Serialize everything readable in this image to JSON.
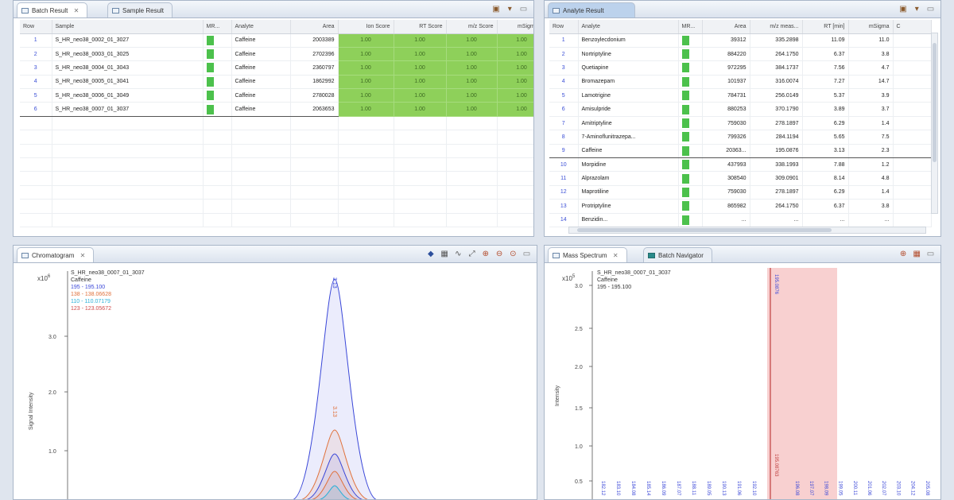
{
  "top_left": {
    "tabs": [
      {
        "label": "Batch Result"
      },
      {
        "label": "Sample Result"
      }
    ],
    "columns": [
      "Row",
      "Sample",
      "MR...",
      "Analyte",
      "Area",
      "Ion Score",
      "RT Score",
      "m/z Score",
      "mSigma..."
    ],
    "rows": [
      {
        "row": "1",
        "sample": "S_HR_neo38_0002_01_3027",
        "analyte": "Caffeine",
        "area": "2003389",
        "ion": "1.00",
        "rt": "1.00",
        "mz": "1.00",
        "msigma": "1.00"
      },
      {
        "row": "2",
        "sample": "S_HR_neo38_0003_01_3025",
        "analyte": "Caffeine",
        "area": "2702396",
        "ion": "1.00",
        "rt": "1.00",
        "mz": "1.00",
        "msigma": "1.00"
      },
      {
        "row": "3",
        "sample": "S_HR_neo38_0004_01_3043",
        "analyte": "Caffeine",
        "area": "2360797",
        "ion": "1.00",
        "rt": "1.00",
        "mz": "1.00",
        "msigma": "1.00"
      },
      {
        "row": "4",
        "sample": "S_HR_neo38_0005_01_3041",
        "analyte": "Caffeine",
        "area": "1862992",
        "ion": "1.00",
        "rt": "1.00",
        "mz": "1.00",
        "msigma": "1.00"
      },
      {
        "row": "5",
        "sample": "S_HR_neo38_0006_01_3049",
        "analyte": "Caffeine",
        "area": "2780028",
        "ion": "1.00",
        "rt": "1.00",
        "mz": "1.00",
        "msigma": "1.00"
      },
      {
        "row": "6",
        "sample": "S_HR_neo38_0007_01_3037",
        "analyte": "Caffeine",
        "area": "2063653",
        "ion": "1.00",
        "rt": "1.00",
        "mz": "1.00",
        "msigma": "1.00"
      }
    ]
  },
  "top_right": {
    "tabs": [
      {
        "label": "Analyte Result"
      }
    ],
    "columns": [
      "Row",
      "Analyte",
      "MR...",
      "Area",
      "m/z meas...",
      "RT [min]",
      "mSigma",
      "C"
    ],
    "rows": [
      {
        "row": "1",
        "analyte": "Benzoylecdonium",
        "area": "39312",
        "mz": "335.2898",
        "rt": "11.09",
        "msigma": "11.0"
      },
      {
        "row": "2",
        "analyte": "Nortriptyline",
        "area": "884220",
        "mz": "264.1750",
        "rt": "6.37",
        "msigma": "3.8"
      },
      {
        "row": "3",
        "analyte": "Quetiapine",
        "area": "972295",
        "mz": "384.1737",
        "rt": "7.56",
        "msigma": "4.7"
      },
      {
        "row": "4",
        "analyte": "Bromazepam",
        "area": "101937",
        "mz": "316.0074",
        "rt": "7.27",
        "msigma": "14.7"
      },
      {
        "row": "5",
        "analyte": "Lamotrigine",
        "area": "784731",
        "mz": "256.0149",
        "rt": "5.37",
        "msigma": "3.9"
      },
      {
        "row": "6",
        "analyte": "Amisulpride",
        "area": "880253",
        "mz": "370.1790",
        "rt": "3.89",
        "msigma": "3.7"
      },
      {
        "row": "7",
        "analyte": "Amitriptyline",
        "area": "759030",
        "mz": "278.1897",
        "rt": "6.29",
        "msigma": "1.4"
      },
      {
        "row": "8",
        "analyte": "7-Aminoflunitrazepa...",
        "area": "799326",
        "mz": "284.1194",
        "rt": "5.65",
        "msigma": "7.5"
      },
      {
        "row": "9",
        "analyte": "Caffeine",
        "area": "20363...",
        "mz": "195.0876",
        "rt": "3.13",
        "msigma": "2.3"
      },
      {
        "row": "10",
        "analyte": "Morpidine",
        "area": "437993",
        "mz": "338.1993",
        "rt": "7.88",
        "msigma": "1.2"
      },
      {
        "row": "11",
        "analyte": "Alprazolam",
        "area": "308540",
        "mz": "309.0901",
        "rt": "8.14",
        "msigma": "4.8"
      },
      {
        "row": "12",
        "analyte": "Maprotiline",
        "area": "759030",
        "mz": "278.1897",
        "rt": "6.29",
        "msigma": "1.4"
      },
      {
        "row": "13",
        "analyte": "Protriptyline",
        "area": "865982",
        "mz": "264.1750",
        "rt": "6.37",
        "msigma": "3.8"
      },
      {
        "row": "14",
        "analyte": "Benzidin...",
        "area": "...",
        "mz": "...",
        "rt": "...",
        "msigma": "..."
      }
    ]
  },
  "bottom_left": {
    "tabs": [
      {
        "label": "Chromatogram"
      }
    ],
    "y_axis_label": "Signal Intensity",
    "y_exponent": "x10",
    "y_exponent_power": "6",
    "y_ticks": [
      "3.0",
      "2.0",
      "1.0"
    ],
    "legend": [
      {
        "text": "S_HR_neo38_0007_01_3037",
        "color": "#333333"
      },
      {
        "text": "Caffeine",
        "color": "#333333"
      },
      {
        "text": "195 - 195.100",
        "color": "#3a47d8"
      },
      {
        "text": "138 - 138.06628",
        "color": "#e0703a"
      },
      {
        "text": "110 - 110.07179",
        "color": "#2ab0d8"
      },
      {
        "text": "123 - 123.05672",
        "color": "#d04a4a"
      }
    ],
    "peak_label_top": "3.13",
    "peak_label_mid": "3.13",
    "colors": {
      "blue": "#3a47d8",
      "orange": "#e0703a",
      "cyan": "#2ab0d8"
    }
  },
  "bottom_right": {
    "tabs": [
      {
        "label": "Mass Spectrum"
      },
      {
        "label": "Batch Navigator"
      }
    ],
    "y_axis_label": "Intensity",
    "y_exponent": "x10",
    "y_exponent_power": "5",
    "y_ticks": [
      "3.0",
      "2.5",
      "2.0",
      "1.5",
      "1.0",
      "0.5"
    ],
    "legend": [
      {
        "text": "S_HR_neo38_0007_01_3037"
      },
      {
        "text": "Caffeine"
      },
      {
        "text": "195 - 195.100"
      }
    ],
    "highlight_label": "195.0876",
    "peak_label": "195.08763",
    "peak_labels_left": [
      "182.12",
      "183.10",
      "184.08",
      "185.14",
      "186.09",
      "187.07",
      "188.11",
      "189.05",
      "190.13",
      "191.06",
      "192.10"
    ],
    "peak_labels_right": [
      "196.08",
      "197.07",
      "198.09",
      "199.05",
      "200.11",
      "201.06",
      "202.07",
      "203.10",
      "204.12",
      "205.08"
    ],
    "highlight_color": "#f8d0d0"
  }
}
